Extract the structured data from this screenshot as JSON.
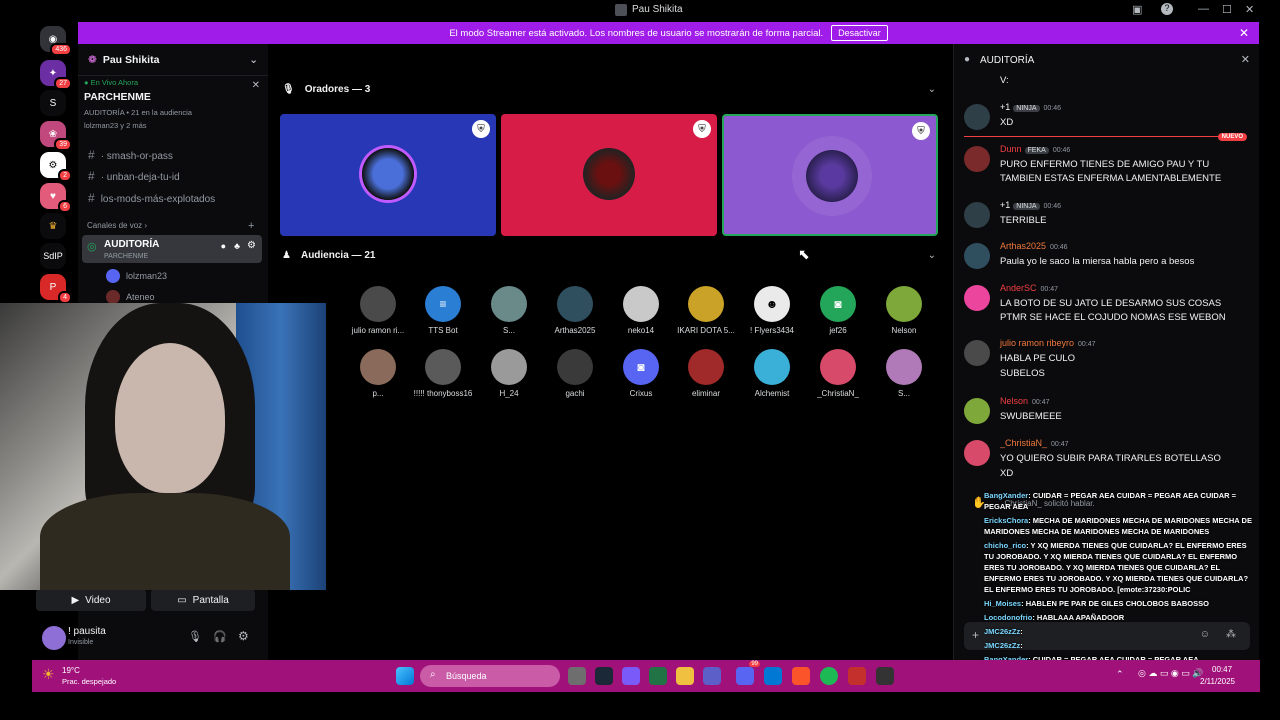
{
  "window": {
    "title": "Pau Shikita"
  },
  "banner": {
    "text": "El modo Streamer está activado. Los nombres de usuario se mostrarán de forma parcial.",
    "button": "Desactivar"
  },
  "rail": {
    "badges": [
      "436",
      "27",
      "39",
      "2",
      "6",
      "4"
    ],
    "labels": [
      "S",
      "SdIP"
    ]
  },
  "sidebar": {
    "guild_name": "Pau Shikita",
    "live": {
      "label": "En Vivo Ahora",
      "stage": "PARCHENME",
      "meta": "AUDITORÍA  •  21 en la audiencia",
      "people": "lolzman23 y 2 más"
    },
    "channels": [
      "smash-or-pass",
      "unban-deja-tu-id",
      "los-mods-más-explotados"
    ],
    "voice_category": "Canales de voz",
    "voice_channel": {
      "name": "AUDITORÍA",
      "sub": "PARCHENME"
    },
    "voice_users": [
      "lolzman23",
      "Ateneo"
    ],
    "video_button": "Video",
    "screen_button": "Pantalla",
    "user": {
      "name": "! pausita",
      "status": "Invisible"
    }
  },
  "stage": {
    "speakers_header": "Oradores — 3",
    "audience_header": "Audiencia — 21",
    "audience_row1": [
      "julio ramon ri...",
      "TTS Bot",
      "S...",
      "Arthas2025",
      "neko14",
      "IKARI DOTA 5...",
      "! Flyers3434",
      "jef26",
      "Nelson"
    ],
    "audience_row2": [
      "p...",
      "!!!!! thonyboss16",
      "H_24",
      "gachi",
      "Crixus",
      "eliminar",
      "Alchemist",
      "_ChristiaN_",
      "S..."
    ],
    "audience_partial": [
      "",
      ""
    ]
  },
  "chat": {
    "title": "AUDITORÍA",
    "first_line": "V:",
    "new_label": "NUEVO",
    "messages": [
      {
        "user": "+1",
        "tag": "NINJA",
        "time": "00:46",
        "text": "XD",
        "color": "#f2f3f5"
      },
      {
        "user": "Dunn",
        "tag": "FEKA",
        "time": "00:46",
        "text": "PURO ENFERMO TIENES DE AMIGO PAU Y TU TAMBIEN ESTAS ENFERMA LAMENTABLEMENTE",
        "color": "#f23f43"
      },
      {
        "user": "+1",
        "tag": "NINJA",
        "time": "00:46",
        "text": "TERRIBLE",
        "color": "#f2f3f5"
      },
      {
        "user": "Arthas2025",
        "tag": "",
        "time": "00:46",
        "text": "Paula yo le saco la miersa habla pero a besos",
        "color": "#f0783c"
      },
      {
        "user": "AnderSC",
        "tag": "",
        "time": "00:47",
        "text": "LA BOTO DE SU JATO LE DESARMO SUS COSAS PTMR SE HACE EL COJUDO NOMAS ESE WEBON",
        "color": "#f23f43"
      },
      {
        "user": "julio ramon ribeyro",
        "tag": "",
        "time": "00:47",
        "text": "HABLA PE CULO",
        "color": "#f0783c"
      },
      {
        "user": "",
        "tag": "",
        "time": "",
        "text": "SUBELOS",
        "color": "#f2f3f5"
      },
      {
        "user": "Nelson",
        "tag": "",
        "time": "00:47",
        "text": "SWUBEMEEE",
        "color": "#f23f43"
      },
      {
        "user": "_ChristiaN_",
        "tag": "",
        "time": "00:47",
        "text": "YO QUIERO SUBIR PARA TIRARLES BOTELLASO",
        "color": "#f0783c"
      },
      {
        "user": "",
        "tag": "",
        "time": "",
        "text": "XD",
        "color": "#f2f3f5"
      }
    ],
    "hand_raise": "_ChristiaN_ solicitó hablar."
  },
  "overlay": [
    {
      "u": "BangXander",
      "t": ": CUIDAR = PEGAR AEA    CUIDAR = PEGAR AEA    CUIDAR = PEGAR AEA"
    },
    {
      "u": "EricksChora",
      "t": ": MECHA DE MARIDONES    MECHA DE MARIDONES    MECHA DE MARIDONES    MECHA DE MARIDONES    MECHA DE MARIDONES"
    },
    {
      "u": "chicho_rico",
      "t": ": Y XQ MIERDA TIENES QUE CUIDARLA? EL ENFERMO ERES TU JOROBADO.    Y XQ MIERDA TIENES QUE CUIDARLA? EL ENFERMO ERES TU JOROBADO.    Y XQ MIERDA TIENES QUE CUIDARLA? EL ENFERMO ERES TU JOROBADO.    Y XQ MIERDA TIENES QUE CUIDARLA? EL ENFERMO ERES TU JOROBADO. [emote:37230:POLIC"
    },
    {
      "u": "Hi_Moises",
      "t": ": HABLEN PE PAR DE GILES CHOLOBOS BABOSSO"
    },
    {
      "u": "Locodonofrio",
      "t": ": HABLAAA APAÑADOOR"
    },
    {
      "u": "JMC26zZz",
      "t": ":"
    },
    {
      "u": "JMC26zZz",
      "t": ":"
    },
    {
      "u": "BangXander",
      "t": ": CUIDAR = PEGAR AEA    CUIDAR = PEGAR AEA"
    }
  ],
  "taskbar": {
    "temp": "19°C",
    "weather": "Prac. despejado",
    "search": "Búsqueda",
    "time": "00:47",
    "date": "2/11/2025",
    "badge": "99"
  }
}
